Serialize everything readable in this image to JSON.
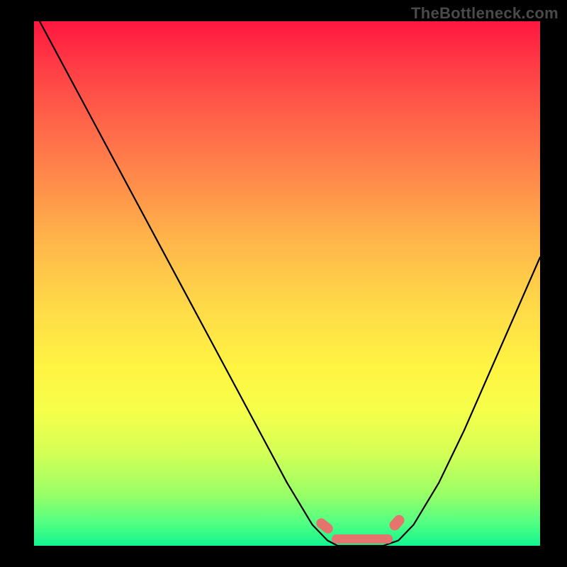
{
  "watermark": "TheBottleneck.com",
  "colors": {
    "frame": "#000000",
    "watermark": "#4a4a4a",
    "curve": "#000000",
    "marker": "#e5736e"
  },
  "chart_data": {
    "type": "line",
    "title": "",
    "xlabel": "",
    "ylabel": "",
    "xlim": [
      0,
      100
    ],
    "ylim": [
      0,
      100
    ],
    "grid": false,
    "legend": false,
    "series": [
      {
        "name": "bottleneck-curve",
        "x": [
          0,
          5,
          10,
          15,
          20,
          25,
          30,
          35,
          40,
          45,
          50,
          55,
          58,
          60,
          63,
          66,
          69,
          72,
          75,
          80,
          85,
          90,
          95,
          100
        ],
        "y": [
          102,
          93,
          84,
          75,
          66,
          57,
          48,
          39,
          30,
          21,
          12,
          4,
          1,
          0,
          0,
          0,
          0,
          1,
          4,
          12,
          22,
          33,
          44,
          55
        ]
      }
    ],
    "markers": [
      {
        "name": "optimal-range-left-cap",
        "shape": "round",
        "x": 57.5,
        "y": 2.0
      },
      {
        "name": "optimal-range-flat",
        "shape": "round",
        "x_range": [
          60,
          70
        ],
        "y": 0.4
      },
      {
        "name": "optimal-range-right-cap",
        "shape": "round",
        "x": 72.5,
        "y": 2.5
      }
    ],
    "background_gradient": {
      "direction": "vertical",
      "stops": [
        {
          "pos": 0.0,
          "color": "#ff173f"
        },
        {
          "pos": 0.3,
          "color": "#ff8a4a"
        },
        {
          "pos": 0.6,
          "color": "#fff442"
        },
        {
          "pos": 0.9,
          "color": "#9bff66"
        },
        {
          "pos": 1.0,
          "color": "#12f58f"
        }
      ]
    }
  }
}
